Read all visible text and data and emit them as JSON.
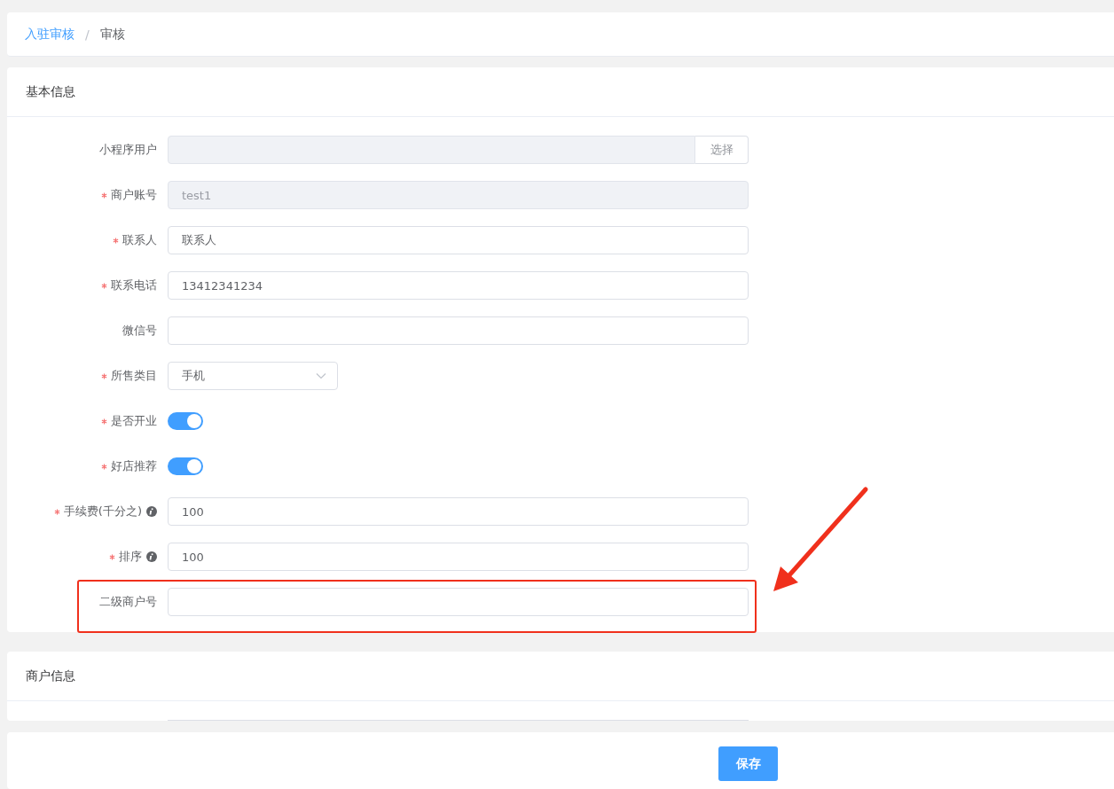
{
  "breadcrumb": [
    {
      "label": "入驻审核",
      "link": true
    },
    {
      "label": "审核",
      "link": false
    }
  ],
  "breadcrumb_separator": "/",
  "sections": [
    {
      "title": "基本信息",
      "fields": [
        {
          "kind": "input-button",
          "label": "小程序用户",
          "required": false,
          "button": "选择",
          "disabled": true
        },
        {
          "kind": "input",
          "label": "商户账号",
          "required": true,
          "value": "test1",
          "disabled": true
        },
        {
          "kind": "input",
          "label": "联系人",
          "required": true,
          "value": "联系人",
          "disabled": false
        },
        {
          "kind": "input",
          "label": "联系电话",
          "required": true,
          "value": "13412341234",
          "disabled": false
        },
        {
          "kind": "input",
          "label": "微信号",
          "required": false,
          "disabled": false
        },
        {
          "kind": "select",
          "label": "所售类目",
          "required": true,
          "value": "手机"
        },
        {
          "kind": "switch",
          "label": "是否开业",
          "required": true,
          "on": true
        },
        {
          "kind": "switch",
          "label": "好店推荐",
          "required": true,
          "on": true
        },
        {
          "kind": "input",
          "label": "手续费(千分之)",
          "required": true,
          "info": true,
          "value": "100",
          "disabled": false
        },
        {
          "kind": "input",
          "label": "排序",
          "required": true,
          "info": true,
          "value": "100",
          "disabled": false
        },
        {
          "kind": "input",
          "label": "二级商户号",
          "required": false,
          "disabled": false,
          "highlighted": true
        }
      ]
    },
    {
      "title": "商户信息",
      "fields": [
        {
          "kind": "input-edge"
        }
      ]
    }
  ],
  "footer": {
    "save_button": "保存"
  }
}
